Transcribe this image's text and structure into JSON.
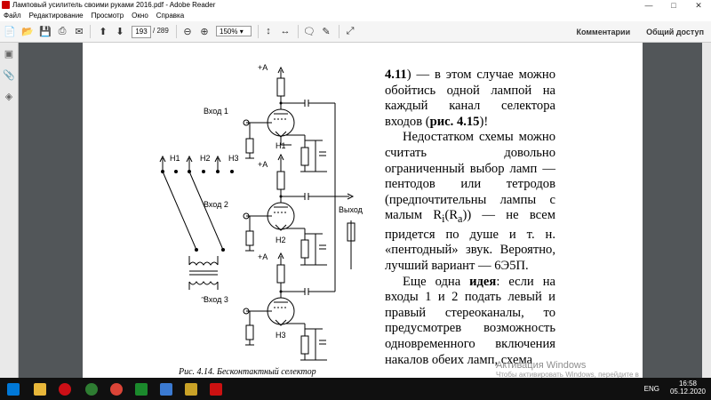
{
  "window": {
    "title": "Ламповый усилитель своими руками  2016.pdf - Adobe Reader"
  },
  "menu": [
    "Файл",
    "Редактирование",
    "Просмотр",
    "Окно",
    "Справка"
  ],
  "toolbar": {
    "page_current": "193",
    "page_total": "/ 289",
    "zoom": "150%",
    "comments_label": "Комментарии",
    "share_label": "Общий доступ"
  },
  "document": {
    "paragraphs": [
      {
        "parts": [
          {
            "t": "4.11",
            "b": true
          },
          {
            "t": ") — в этом случае можно обойтись одной лампой на каждый канал селектора входов ("
          },
          {
            "t": "рис. 4.15",
            "b": true
          },
          {
            "t": ")!"
          }
        ]
      },
      {
        "indent": true,
        "parts": [
          {
            "t": "Недостатком схемы можно считать довольно ограниченный выбор ламп — пентодов или тетродов (предпочтительны лампы с малым R"
          },
          {
            "t": "i",
            "sub": true
          },
          {
            "t": "(R"
          },
          {
            "t": "a",
            "sub": true
          },
          {
            "t": ")) — не всем придется по душе и т. н. «пентодный» звук. Вероятно, лучший вариант — 6Э5П."
          }
        ]
      },
      {
        "indent": true,
        "parts": [
          {
            "t": "Еще одна "
          },
          {
            "t": "идея",
            "b": true
          },
          {
            "t": ": если на входы 1 и 2 подать левый и правый стереоканалы, то предусмотрев возможность одновременного включения накалов обеих ламп, схема"
          }
        ]
      }
    ],
    "figure_caption": "Рис. 4.14. Бесконтактный селектор"
  },
  "schematic": {
    "plus_a": "+A",
    "inputs": [
      "Вход 1",
      "Вход 2",
      "Вход 3"
    ],
    "heaters": [
      "Н1",
      "Н2",
      "Н3"
    ],
    "switch_labels": [
      "Н1",
      "Н2",
      "Н3"
    ],
    "output": "Выход",
    "tilde": "~"
  },
  "watermark": {
    "title": "Активация Windows",
    "subtitle": "Чтобы активировать Windows, перейдите в раздел \"Параметры\"."
  },
  "taskbar": {
    "lang": "ENG",
    "time": "16:58",
    "date": "05.12.2020"
  }
}
